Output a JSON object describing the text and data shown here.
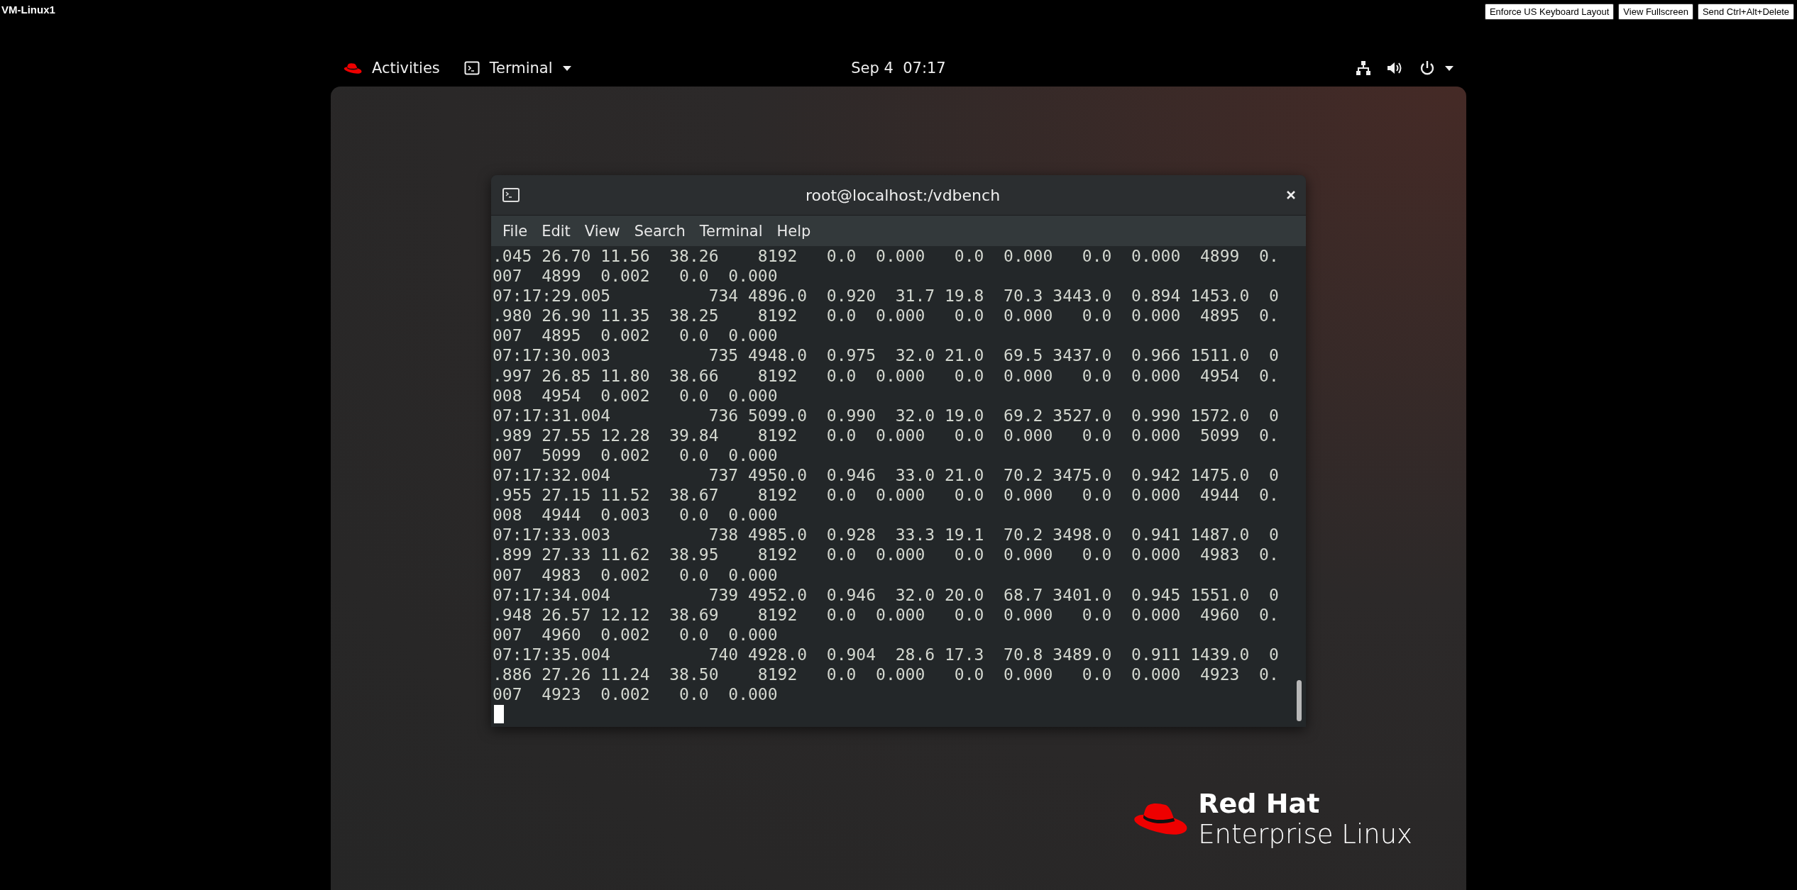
{
  "vm_label": "VM-Linux1",
  "toolbar_buttons": [
    "Enforce US Keyboard Layout",
    "View Fullscreen",
    "Send Ctrl+Alt+Delete"
  ],
  "top_bar": {
    "activities": "Activities",
    "app_menu": "Terminal",
    "clock": "Sep 4  07:17"
  },
  "terminal": {
    "title": "root@localhost:/vdbench",
    "menu": [
      "File",
      "Edit",
      "View",
      "Search",
      "Terminal",
      "Help"
    ],
    "lines": [
      ".045 26.70 11.56  38.26    8192   0.0  0.000   0.0  0.000   0.0  0.000  4899  0.",
      "007  4899  0.002   0.0  0.000",
      "07:17:29.005          734 4896.0  0.920  31.7 19.8  70.3 3443.0  0.894 1453.0  0",
      ".980 26.90 11.35  38.25    8192   0.0  0.000   0.0  0.000   0.0  0.000  4895  0.",
      "007  4895  0.002   0.0  0.000",
      "07:17:30.003          735 4948.0  0.975  32.0 21.0  69.5 3437.0  0.966 1511.0  0",
      ".997 26.85 11.80  38.66    8192   0.0  0.000   0.0  0.000   0.0  0.000  4954  0.",
      "008  4954  0.002   0.0  0.000",
      "07:17:31.004          736 5099.0  0.990  32.0 19.0  69.2 3527.0  0.990 1572.0  0",
      ".989 27.55 12.28  39.84    8192   0.0  0.000   0.0  0.000   0.0  0.000  5099  0.",
      "007  5099  0.002   0.0  0.000",
      "07:17:32.004          737 4950.0  0.946  33.0 21.0  70.2 3475.0  0.942 1475.0  0",
      ".955 27.15 11.52  38.67    8192   0.0  0.000   0.0  0.000   0.0  0.000  4944  0.",
      "008  4944  0.003   0.0  0.000",
      "07:17:33.003          738 4985.0  0.928  33.3 19.1  70.2 3498.0  0.941 1487.0  0",
      ".899 27.33 11.62  38.95    8192   0.0  0.000   0.0  0.000   0.0  0.000  4983  0.",
      "007  4983  0.002   0.0  0.000",
      "07:17:34.004          739 4952.0  0.946  32.0 20.0  68.7 3401.0  0.945 1551.0  0",
      ".948 26.57 12.12  38.69    8192   0.0  0.000   0.0  0.000   0.0  0.000  4960  0.",
      "007  4960  0.002   0.0  0.000",
      "07:17:35.004          740 4928.0  0.904  28.6 17.3  70.8 3489.0  0.911 1439.0  0",
      ".886 27.26 11.24  38.50    8192   0.0  0.000   0.0  0.000   0.0  0.000  4923  0.",
      "007  4923  0.002   0.0  0.000"
    ]
  },
  "logo": {
    "line_1": "Red Hat",
    "line_2": "Enterprise Linux"
  }
}
